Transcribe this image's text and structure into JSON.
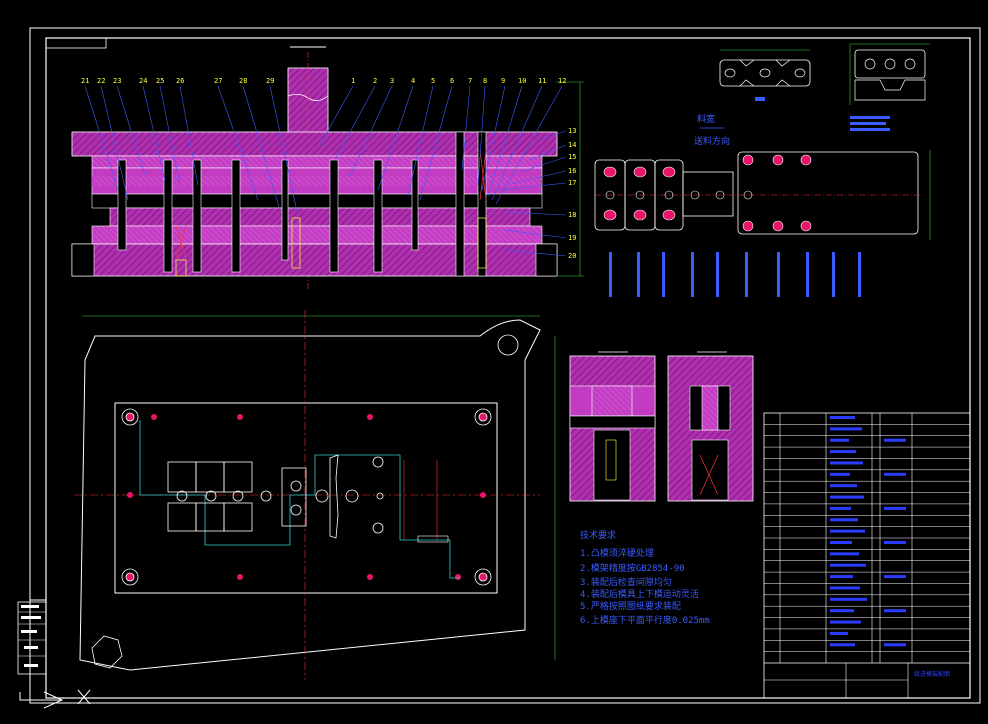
{
  "colors": {
    "background": "#000000",
    "frame": "#ffffff",
    "section_fill": "#b02fb0",
    "hatch": "#7a2a7a",
    "plate_outline": "#ffffff",
    "hole_fill": "#e8156b",
    "label": "#ffff33",
    "leader": "#3a5bff",
    "dim_line": "#33cc33",
    "center_line": "#ff3333",
    "strip": "#dddddd",
    "tech_text": "#3a5bff",
    "cyan": "#33cccc"
  },
  "assembly_part_numbers": [
    "21",
    "22",
    "23",
    "24",
    "25",
    "26",
    "27",
    "28",
    "29",
    "1",
    "2",
    "3",
    "4",
    "5",
    "6",
    "7",
    "8",
    "9",
    "10",
    "11",
    "12"
  ],
  "right_part_numbers": [
    "13",
    "14",
    "15",
    "16",
    "17",
    "18",
    "19",
    "20"
  ],
  "strip_caption": "送料方向",
  "strip_caption_top": "料宽",
  "tech_requirements": {
    "title": "技术要求",
    "items": [
      "1.凸模须淬硬处理",
      "2.模架精度按GB2854-90",
      "3.装配后检查间隙均匀",
      "4.装配后模具上下模运动灵活",
      "5.严格按照图纸要求装配",
      "6.上模座下平面平行度0.025mm"
    ]
  },
  "title_block": {
    "name": "级进模装配图",
    "row_count": 22
  },
  "icons": [
    "ucs-axis-icon",
    "crosshair-icon"
  ]
}
